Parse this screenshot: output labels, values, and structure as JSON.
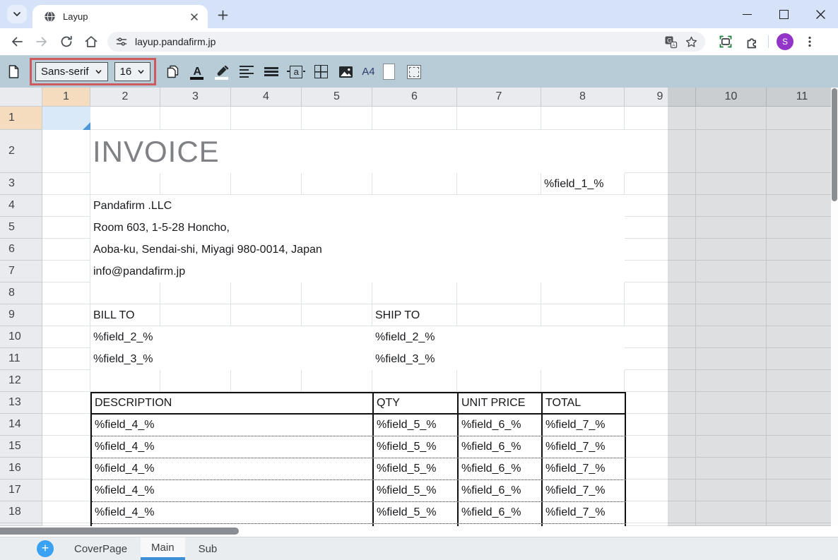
{
  "browser": {
    "tab_title": "Layup",
    "url": "layup.pandafirm.jp",
    "avatar_letter": "S"
  },
  "toolbar": {
    "font_select_value": "Sans-serif",
    "size_select_value": "16",
    "page_size_label": "A4",
    "icon_names": [
      "new-document",
      "copy",
      "font-color",
      "fill-color",
      "horizontal-align",
      "vertical-align",
      "text-fit",
      "cell-borders",
      "insert-image",
      "page-size",
      "page-orientation",
      "print-area"
    ]
  },
  "sheet": {
    "col_headers": [
      "1",
      "2",
      "3",
      "4",
      "5",
      "6",
      "7",
      "8",
      "9",
      "10",
      "11"
    ],
    "row_headers": [
      "1",
      "2",
      "3",
      "4",
      "5",
      "6",
      "7",
      "8",
      "9",
      "10",
      "11",
      "12",
      "13",
      "14",
      "15",
      "16",
      "17",
      "18"
    ],
    "cells": {
      "invoice_title": "INVOICE",
      "field_1": "%field_1_%",
      "company_lines": [
        "Pandafirm .LLC",
        "Room 603, 1-5-28 Honcho,",
        "Aoba-ku, Sendai-shi, Miyagi 980-0014, Japan",
        "info@pandafirm.jp"
      ],
      "bill_to": "BILL TO",
      "ship_to": "SHIP TO",
      "field_2": "%field_2_%",
      "field_3": "%field_3_%",
      "table": {
        "headers": [
          "DESCRIPTION",
          "QTY",
          "UNIT PRICE",
          "TOTAL"
        ],
        "row_values": [
          "%field_4_%",
          "%field_5_%",
          "%field_6_%",
          "%field_7_%"
        ],
        "data_row_count": 5
      }
    }
  },
  "tabs_bar": {
    "tabs": [
      "CoverPage",
      "Main",
      "Sub"
    ],
    "active_tab": "Main"
  },
  "colors": {
    "highlight_box_red": "#cd5a5e",
    "toolbar_background": "#b7ccd7",
    "selected_header_peach": "#f5dcbe",
    "selected_cell_blue": "#d9e9f8",
    "active_sheet_tab_underline": "#3d8fd6",
    "avatar_purple": "#9334c9",
    "invoice_text_gray": "#7f8184",
    "out_of_page_gray": "#d9d9d9"
  }
}
